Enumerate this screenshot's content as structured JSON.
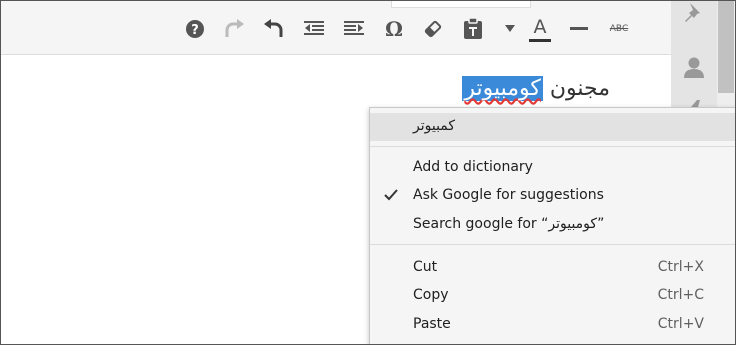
{
  "toolbar": {
    "buttons": [
      {
        "name": "help"
      },
      {
        "name": "redo"
      },
      {
        "name": "undo"
      },
      {
        "name": "outdent"
      },
      {
        "name": "indent"
      },
      {
        "name": "special-character"
      },
      {
        "name": "clear-formatting"
      },
      {
        "name": "paste-as-text"
      },
      {
        "name": "text-color-dropdown"
      },
      {
        "name": "text-color"
      },
      {
        "name": "horizontal-line"
      },
      {
        "name": "strikethrough"
      }
    ],
    "strikethrough_label": "ABC",
    "text_color_letter": "A",
    "text_color_accent": "#333333",
    "omega_symbol": "Ω"
  },
  "editor": {
    "text_before": "مجنون ",
    "selected_word": "كومبيوتر"
  },
  "context_menu": {
    "suggestion": "كمبيوتر",
    "add_to_dictionary": "Add to dictionary",
    "ask_google": "Ask Google for suggestions",
    "ask_google_checked": true,
    "search_google": "Search google for “كومبيوتر”",
    "cut": {
      "label": "Cut",
      "shortcut": "Ctrl+X"
    },
    "copy": {
      "label": "Copy",
      "shortcut": "Ctrl+C"
    },
    "paste": {
      "label": "Paste",
      "shortcut": "Ctrl+V"
    }
  },
  "colors": {
    "selection": "#3b8ad9",
    "toolbar_bg": "#f5f5f5",
    "sidebar_bg": "#e4e4e4",
    "icon": "#555555",
    "icon_disabled": "#bbbbbb"
  }
}
